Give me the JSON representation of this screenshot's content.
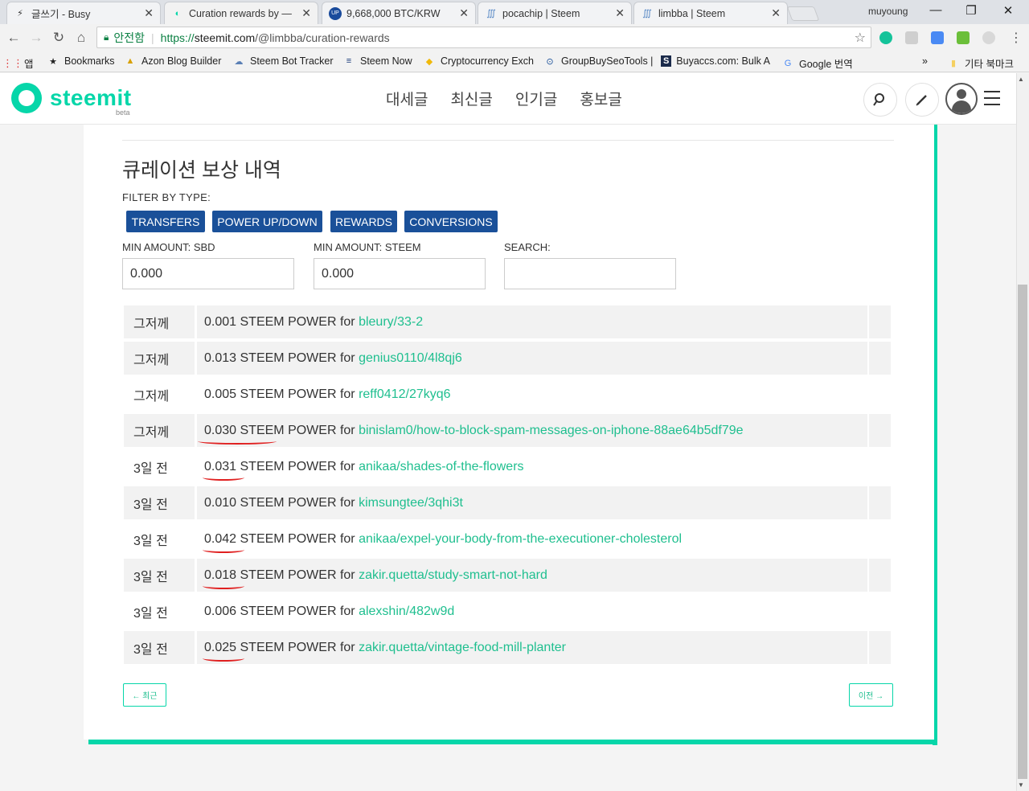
{
  "browser": {
    "tabs": [
      {
        "title": "글쓰기 - Busy"
      },
      {
        "title": "Curation rewards by —"
      },
      {
        "title": "9,668,000 BTC/KRW"
      },
      {
        "title": "pocachip | Steem"
      },
      {
        "title": "limbba | Steem"
      }
    ],
    "profile_name": "muyoung",
    "secure_label": "안전함",
    "url_prefix": "https://",
    "url_domain": "steemit.com",
    "url_path": "/@limbba/curation-rewards"
  },
  "bookmarks": {
    "apps_label": "앱",
    "items": [
      "Bookmarks",
      "Azon Blog Builder",
      "Steem Bot Tracker",
      "Steem Now",
      "Cryptocurrency Exch",
      "GroupBuySeoTools |",
      "Buyaccs.com: Bulk A",
      "Google 번역"
    ],
    "overflow": "»",
    "other": "기타 북마크"
  },
  "header": {
    "logo_text": "steemit",
    "beta": "beta",
    "nav": [
      "대세글",
      "최신글",
      "인기글",
      "홍보글"
    ]
  },
  "page": {
    "title": "큐레이션 보상 내역",
    "filter_label": "FILTER BY TYPE:",
    "filters": [
      "TRANSFERS",
      "POWER UP/DOWN",
      "REWARDS",
      "CONVERSIONS"
    ],
    "min_sbd_label": "MIN AMOUNT: SBD",
    "min_sbd_value": "0.000",
    "min_steem_label": "MIN AMOUNT: STEEM",
    "min_steem_value": "0.000",
    "search_label": "SEARCH:",
    "search_value": ""
  },
  "rows": [
    {
      "when": "그저께",
      "amount": "0.001",
      "unit": "STEEM POWER for",
      "link": "bleury/33-2"
    },
    {
      "when": "그저께",
      "amount": "0.013",
      "unit": "STEEM POWER for",
      "link": "genius0110/4l8qj6"
    },
    {
      "when": "그저께",
      "amount": "0.005",
      "unit": "STEEM POWER for",
      "link": "reff0412/27kyq6"
    },
    {
      "when": "그저께",
      "amount": "0.030",
      "unit": "STEEM POWER for",
      "link": "binislam0/how-to-block-spam-messages-on-iphone-88ae64b5df79e"
    },
    {
      "when": "3일 전",
      "amount": "0.031",
      "unit": "STEEM POWER for",
      "link": "anikaa/shades-of-the-flowers"
    },
    {
      "when": "3일 전",
      "amount": "0.010",
      "unit": "STEEM POWER for",
      "link": "kimsungtee/3qhi3t"
    },
    {
      "when": "3일 전",
      "amount": "0.042",
      "unit": "STEEM POWER for",
      "link": "anikaa/expel-your-body-from-the-executioner-cholesterol"
    },
    {
      "when": "3일 전",
      "amount": "0.018",
      "unit": "STEEM POWER for",
      "link": "zakir.quetta/study-smart-not-hard"
    },
    {
      "when": "3일 전",
      "amount": "0.006",
      "unit": "STEEM POWER for",
      "link": "alexshin/482w9d"
    },
    {
      "when": "3일 전",
      "amount": "0.025",
      "unit": "STEEM POWER for",
      "link": "zakir.quetta/vintage-food-mill-planter"
    }
  ],
  "pager": {
    "newer": "← 최근",
    "older": "이전 →"
  },
  "colors": {
    "accent": "#06d6a9",
    "link": "#1fbf8f",
    "filter_button": "#1a5099",
    "underline_mark": "#e02020"
  }
}
